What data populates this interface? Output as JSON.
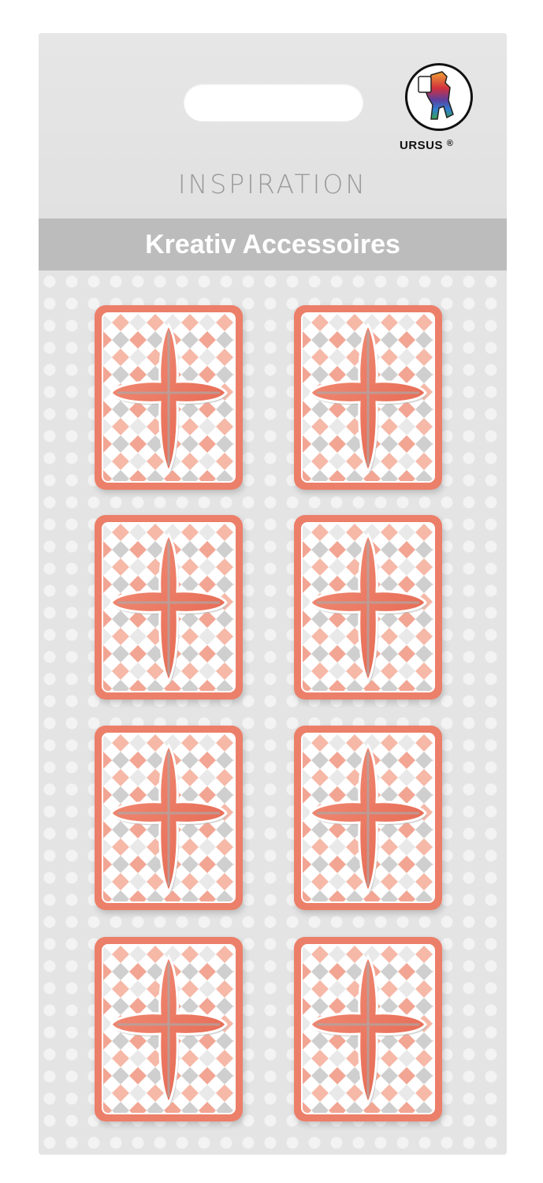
{
  "brand": {
    "name": "URSUS",
    "registered_mark": "®"
  },
  "header": {
    "line_title": "INSPIRATION",
    "band_title": "Kreativ Accessoires"
  },
  "product": {
    "item_count": 8,
    "motif": "cross-icon",
    "colors": {
      "frame": "#ec7f69",
      "cross": "#e8705a",
      "diamond_salmon": "#f6b8a7",
      "diamond_grey": "#cfcfcf",
      "card": "#e3e3e3",
      "band": "#bcbcbc"
    }
  }
}
